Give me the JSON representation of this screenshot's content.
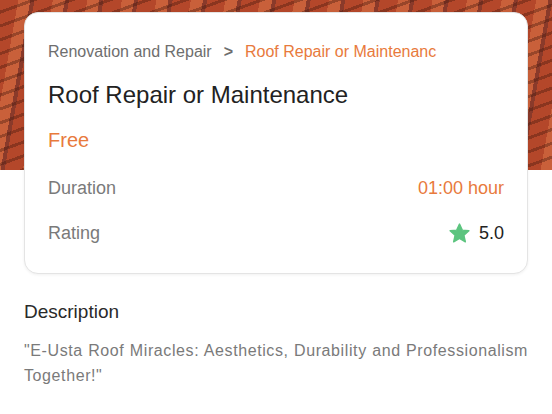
{
  "breadcrumb": {
    "parent": "Renovation and Repair",
    "separator": ">",
    "current": "Roof Repair or Maintenanc"
  },
  "service": {
    "title": "Roof Repair or Maintenance",
    "price": "Free"
  },
  "details": [
    {
      "label": "Duration",
      "value": "01:00 hour",
      "kind": "text"
    },
    {
      "label": "Rating",
      "value": "5.0",
      "kind": "rating"
    }
  ],
  "description": {
    "heading": "Description",
    "text": "\"E-Usta Roof Miracles: Aesthetics, Durability and Professionalism Together!\""
  }
}
